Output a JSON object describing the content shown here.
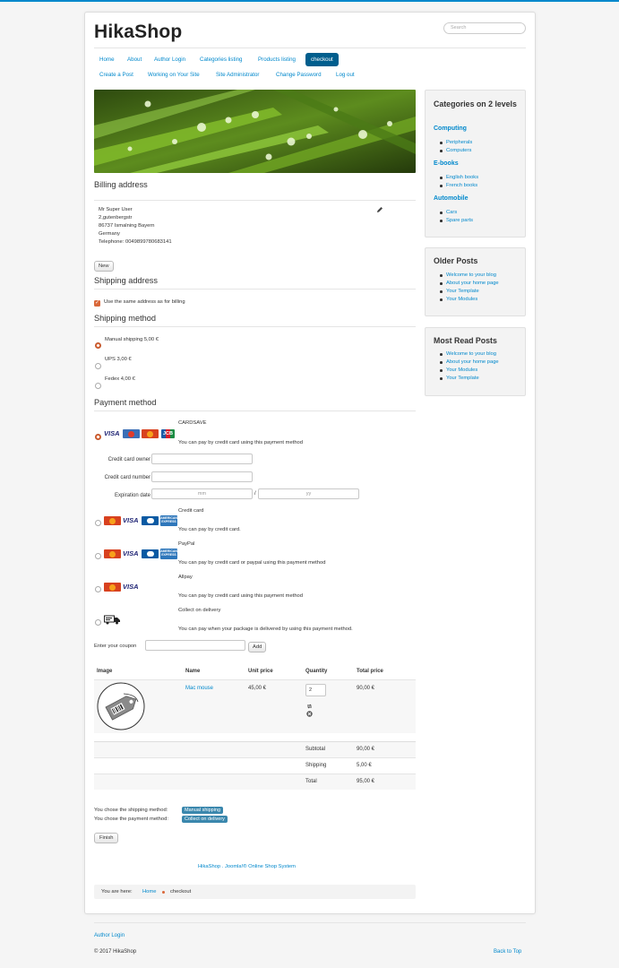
{
  "site": {
    "title": "HikaShop",
    "search_placeholder": "Search"
  },
  "nav": {
    "row1": [
      "Home",
      "About",
      "Author Login",
      "Categories listing",
      "Products listing",
      "checkout"
    ],
    "row2": [
      "Create a Post",
      "Working on Your Site",
      "Site Administrator",
      "Change Password",
      "Log out"
    ]
  },
  "billing": {
    "title": "Billing address",
    "lines": [
      "Mr Super User",
      "2,gutenbergstr",
      "86737 Ismalning Bayern",
      "Germany",
      "Telephone: 0049899780683141"
    ],
    "new_button": "New"
  },
  "shipping_address": {
    "title": "Shipping address",
    "same_label": "Use the same address as for billing"
  },
  "shipping_method": {
    "title": "Shipping method",
    "options": [
      "Manual shipping 5,00 €",
      "UPS 3,00 €",
      "Fedex 4,00 €"
    ]
  },
  "payment": {
    "title": "Payment method",
    "cardsave": {
      "name": "CARDSAVE",
      "desc": "You can pay by credit card using this payment method"
    },
    "card_form": {
      "owner_label": "Credit card owner",
      "number_label": "Credit card number",
      "expiry_label": "Expiration date",
      "mm_placeholder": "mm",
      "yy_placeholder": "yy",
      "separator": "/"
    },
    "credit_card": {
      "name": "Credit card",
      "desc": "You can pay by credit card."
    },
    "paypal": {
      "name": "PayPal",
      "desc": "You can pay by credit card or paypal using this payment method"
    },
    "allpay": {
      "name": "Allpay",
      "desc": "You can pay by credit card using this payment method"
    },
    "cod": {
      "name": "Collect on delivery",
      "desc": "You can pay when your package is delivered by using this payment method."
    },
    "card_logo_text": {
      "visa": "VISA",
      "jcb": "JCB",
      "amex": "AMERICAN EXPRESS"
    }
  },
  "coupon": {
    "label": "Enter your coupon",
    "button": "Add"
  },
  "cart": {
    "headers": [
      "Image",
      "Name",
      "Unit price",
      "Quantity",
      "Total price"
    ],
    "row": {
      "name": "Mac mouse",
      "unit_price": "45,00 €",
      "quantity": "2",
      "total": "90,00 €"
    },
    "totals": [
      {
        "label": "Subtotal",
        "value": "90,00 €"
      },
      {
        "label": "Shipping",
        "value": "5,00 €"
      },
      {
        "label": "Total",
        "value": "95,00 €"
      }
    ]
  },
  "summary": {
    "shipping_text": "You chose the shipping method:",
    "shipping_badge": "Manual shipping",
    "payment_text": "You chose the payment method:",
    "payment_badge": "Collect on delivery",
    "finish_button": "Finish"
  },
  "footer_link": "HikaShop . Joomla!® Online Shop System",
  "breadcrumb": {
    "prefix": "You are here:",
    "home": "Home",
    "current": "checkout"
  },
  "sidebar": {
    "categories": {
      "title": "Categories on 2 levels",
      "groups": [
        {
          "name": "Computing",
          "items": [
            "Peripherals",
            "Computers"
          ]
        },
        {
          "name": "E-books",
          "items": [
            "English books",
            "French books"
          ]
        },
        {
          "name": "Automobile",
          "items": [
            "Cars",
            "Spare parts"
          ]
        }
      ]
    },
    "older": {
      "title": "Older Posts",
      "items": [
        "Welcome to your blog",
        "About your home page",
        "Your Template",
        "Your Modules"
      ]
    },
    "most_read": {
      "title": "Most Read Posts",
      "items": [
        "Welcome to your blog",
        "About your home page",
        "Your Modules",
        "Your Template"
      ]
    }
  },
  "page_footer": {
    "author_login": "Author Login",
    "copyright": "© 2017 HikaShop",
    "back_to_top": "Back to Top"
  },
  "colors": {
    "accent": "#0088cc",
    "nav_active": "#005e8d",
    "radio": "#d9683a",
    "badge": "#3a87ad"
  }
}
